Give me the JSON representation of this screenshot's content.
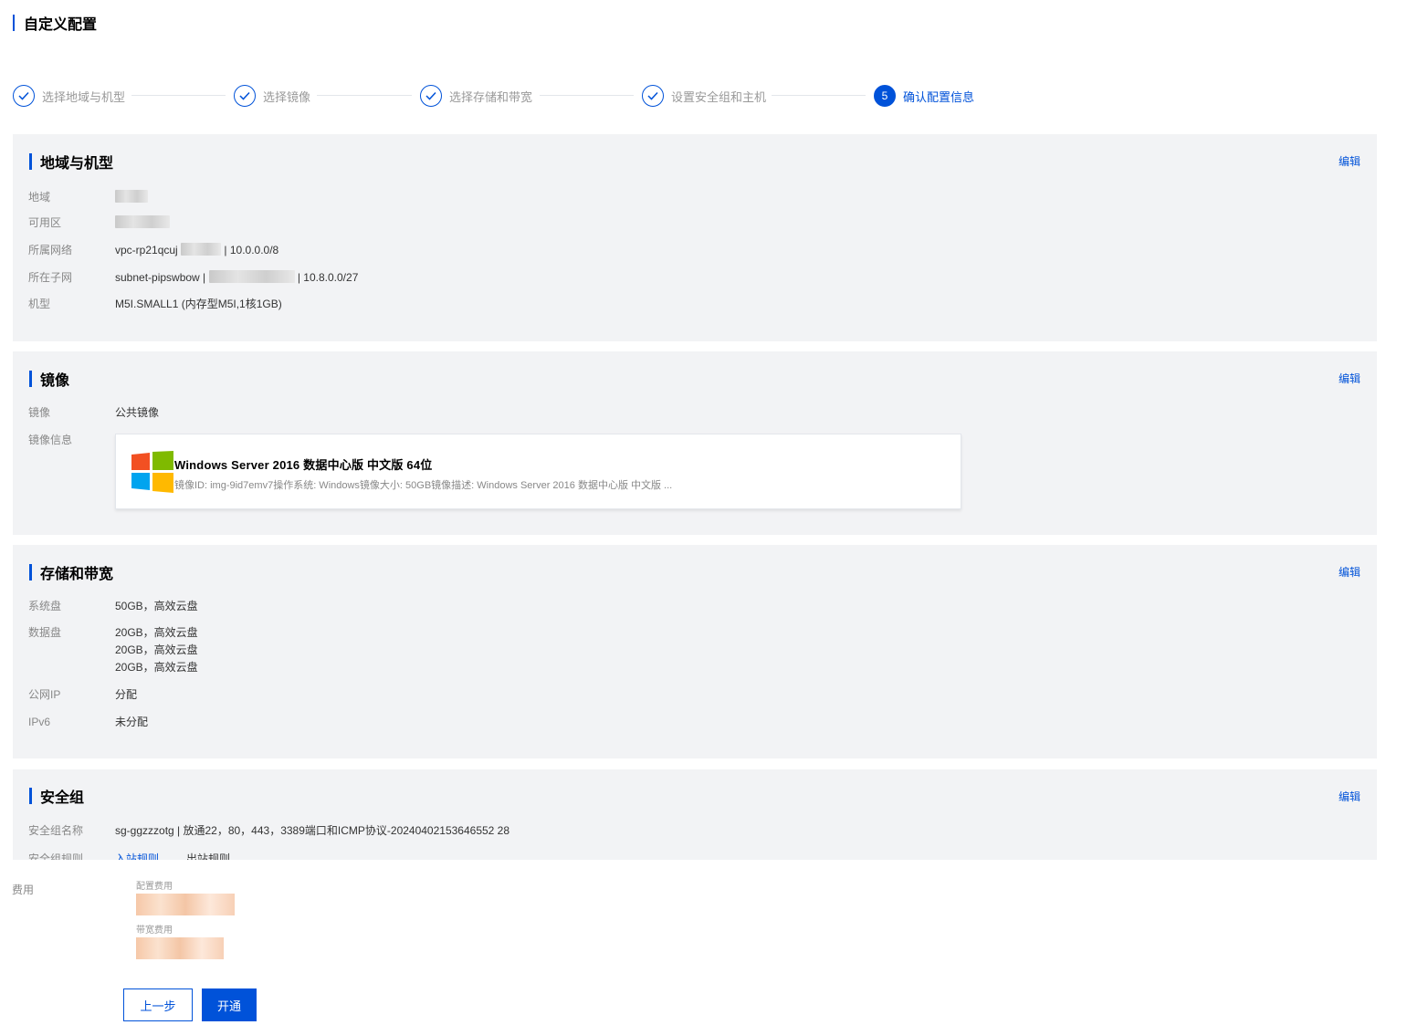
{
  "page": {
    "title": "自定义配置"
  },
  "steps": [
    {
      "label": "选择地域与机型",
      "status": "done"
    },
    {
      "label": "选择镜像",
      "status": "done"
    },
    {
      "label": "选择存储和带宽",
      "status": "done"
    },
    {
      "label": "设置安全组和主机",
      "status": "done"
    },
    {
      "label": "确认配置信息",
      "status": "active",
      "number": "5"
    }
  ],
  "region_card": {
    "title": "地域与机型",
    "edit_label": "编辑",
    "rows": {
      "region": {
        "key": "地域",
        "value": ""
      },
      "zone": {
        "key": "可用区",
        "value": ""
      },
      "network": {
        "key": "所属网络",
        "value_prefix": "vpc-rp21qcuj",
        "value_suffix": "| 10.0.0.0/8"
      },
      "subnet": {
        "key": "所在子网",
        "value_prefix": "subnet-pipswbow |",
        "value_suffix": "| 10.8.0.0/27"
      },
      "instance": {
        "key": "机型",
        "value": "M5I.SMALL1 (内存型M5I,1核1GB)"
      }
    }
  },
  "image_card": {
    "title": "镜像",
    "edit_label": "编辑",
    "image_key": "镜像",
    "image_value": "公共镜像",
    "info_key": "镜像信息",
    "image_name": "Windows Server 2016 数据中心版 中文版 64位",
    "image_meta": "镜像ID: img-9id7emv7操作系统: Windows镜像大小: 50GB镜像描述: Windows Server 2016 数据中心版 中文版 ...",
    "logo_icon": "windows-logo-icon"
  },
  "storage_card": {
    "title": "存储和带宽",
    "edit_label": "编辑",
    "system_disk": {
      "key": "系统盘",
      "value": "50GB，高效云盘"
    },
    "data_disk": {
      "key": "数据盘",
      "values": [
        "20GB，高效云盘",
        "20GB，高效云盘",
        "20GB，高效云盘"
      ]
    },
    "public_ip": {
      "key": "公网IP",
      "value": "分配"
    },
    "ipv6": {
      "key": "IPv6",
      "value": "未分配"
    }
  },
  "security_card": {
    "title": "安全组",
    "edit_label": "编辑",
    "sg_name": {
      "key": "安全组名称",
      "value": "sg-ggzzzotg | 放通22，80，443，3389端口和ICMP协议-20240402153646552 28"
    },
    "sg_rules": {
      "key": "安全组规则",
      "tab_in": "入站规则",
      "tab_out": "出站规则"
    }
  },
  "fees": {
    "label": "费用",
    "config_fee_label": "配置费用",
    "bandwidth_fee_label": "带宽费用"
  },
  "actions": {
    "prev_label": "上一步",
    "submit_label": "开通"
  },
  "colors": {
    "primary": "#0052d9",
    "card_bg": "#f2f3f5",
    "muted_text": "#888888"
  }
}
